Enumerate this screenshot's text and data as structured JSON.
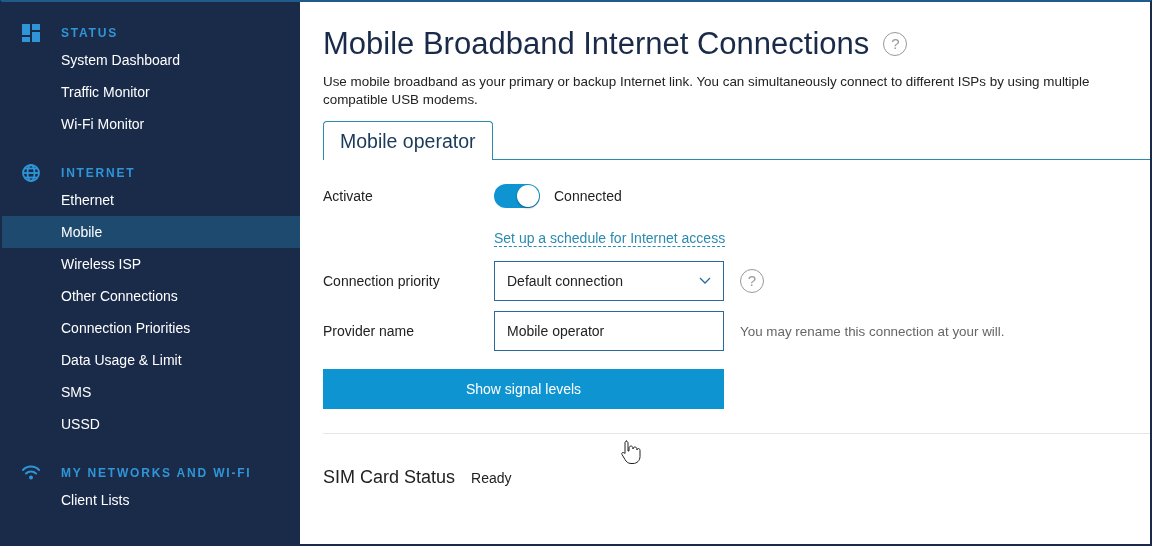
{
  "sidebar": {
    "sections": [
      {
        "kind": "dashboard",
        "title": "STATUS",
        "items": [
          {
            "label": "System Dashboard",
            "selected": false
          },
          {
            "label": "Traffic Monitor",
            "selected": false
          },
          {
            "label": "Wi-Fi Monitor",
            "selected": false
          }
        ]
      },
      {
        "kind": "globe",
        "title": "INTERNET",
        "items": [
          {
            "label": "Ethernet",
            "selected": false
          },
          {
            "label": "Mobile",
            "selected": true
          },
          {
            "label": "Wireless ISP",
            "selected": false
          },
          {
            "label": "Other Connections",
            "selected": false
          },
          {
            "label": "Connection Priorities",
            "selected": false
          },
          {
            "label": "Data Usage & Limit",
            "selected": false
          },
          {
            "label": "SMS",
            "selected": false
          },
          {
            "label": "USSD",
            "selected": false
          }
        ]
      },
      {
        "kind": "wifi",
        "title": "MY NETWORKS AND WI-FI",
        "items": [
          {
            "label": "Client Lists",
            "selected": false
          }
        ]
      }
    ]
  },
  "page": {
    "title": "Mobile Broadband Internet Connections",
    "help_icon": "?",
    "description": "Use mobile broadband as your primary or backup Internet link. You can simultaneously connect to different ISPs by using multiple compatible USB modems.",
    "tabs": [
      {
        "label": "Mobile operator",
        "selected": true
      }
    ],
    "activate": {
      "label": "Activate",
      "on": true,
      "state_text": "Connected"
    },
    "schedule_link": "Set up a schedule for Internet access",
    "priority": {
      "label": "Connection priority",
      "value": "Default connection",
      "help_icon": "?"
    },
    "provider": {
      "label": "Provider name",
      "value": "Mobile operator",
      "hint": "You may rename this connection at your will."
    },
    "button": "Show signal levels",
    "sim": {
      "label": "SIM Card Status",
      "value": "Ready"
    }
  }
}
